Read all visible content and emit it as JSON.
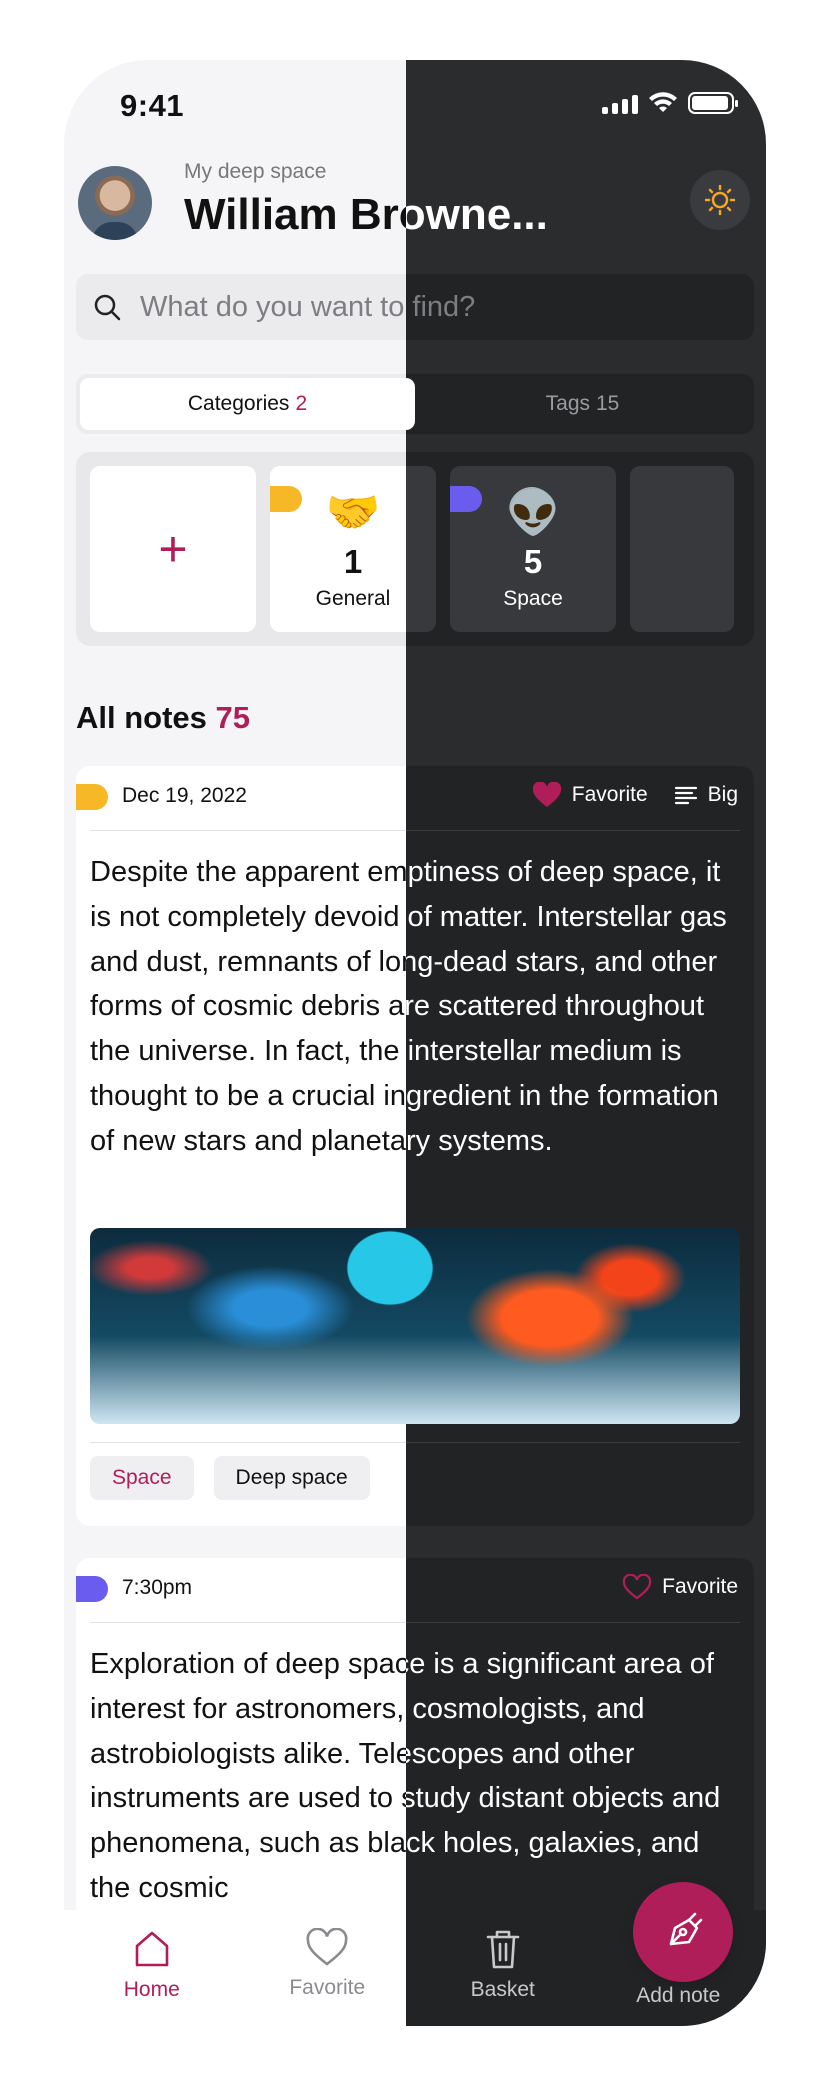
{
  "status_bar": {
    "time": "9:41"
  },
  "profile": {
    "subtitle": "My deep space",
    "name": "William Browne..."
  },
  "search": {
    "placeholder": "What do you want to find?"
  },
  "segments": {
    "categories_label": "Categories",
    "categories_count": "2",
    "tags_label": "Tags",
    "tags_count": "15"
  },
  "categories": [
    {
      "emoji": "🤝",
      "count": "1",
      "name": "General",
      "color": "#f6b827"
    },
    {
      "emoji": "👽",
      "count": "5",
      "name": "Space",
      "color": "#6b5cf0"
    }
  ],
  "add_category": {
    "symbol": "+"
  },
  "notes_section": {
    "title": "All notes",
    "count": "75"
  },
  "notes": [
    {
      "date": "Dec 19, 2022",
      "tab_color": "#f6b827",
      "favorite_label": "Favorite",
      "favorite_filled": true,
      "size_label": "Big",
      "text": "Despite the apparent emptiness of deep space, it is not completely devoid of matter. Interstellar gas and dust, remnants of long-dead stars, and other forms of cosmic debris are scattered throughout the universe. In fact, the interstellar medium is thought to be a crucial ingredient in the formation of new stars and planetary systems.",
      "tags": [
        "Space",
        "Deep space"
      ]
    },
    {
      "date": "7:30pm",
      "tab_color": "#6b5cf0",
      "favorite_label": "Favorite",
      "favorite_filled": false,
      "text": "Exploration of deep space is a significant area of interest for astronomers, cosmologists, and astrobiologists alike. Telescopes and other instruments are used to study distant objects and phenomena, such as black holes, galaxies, and the cosmic"
    }
  ],
  "tabbar": {
    "home": "Home",
    "favorite": "Favorite",
    "basket": "Basket",
    "add_note": "Add note"
  },
  "colors": {
    "accent": "#b01e5a",
    "light_bg": "#f5f5f7",
    "dark_bg": "#2b2c2e",
    "sun": "#f5a623"
  },
  "icons": [
    "search-icon",
    "sun-icon",
    "heart-icon",
    "lines-icon",
    "home-icon",
    "trash-icon",
    "pen-icon"
  ]
}
